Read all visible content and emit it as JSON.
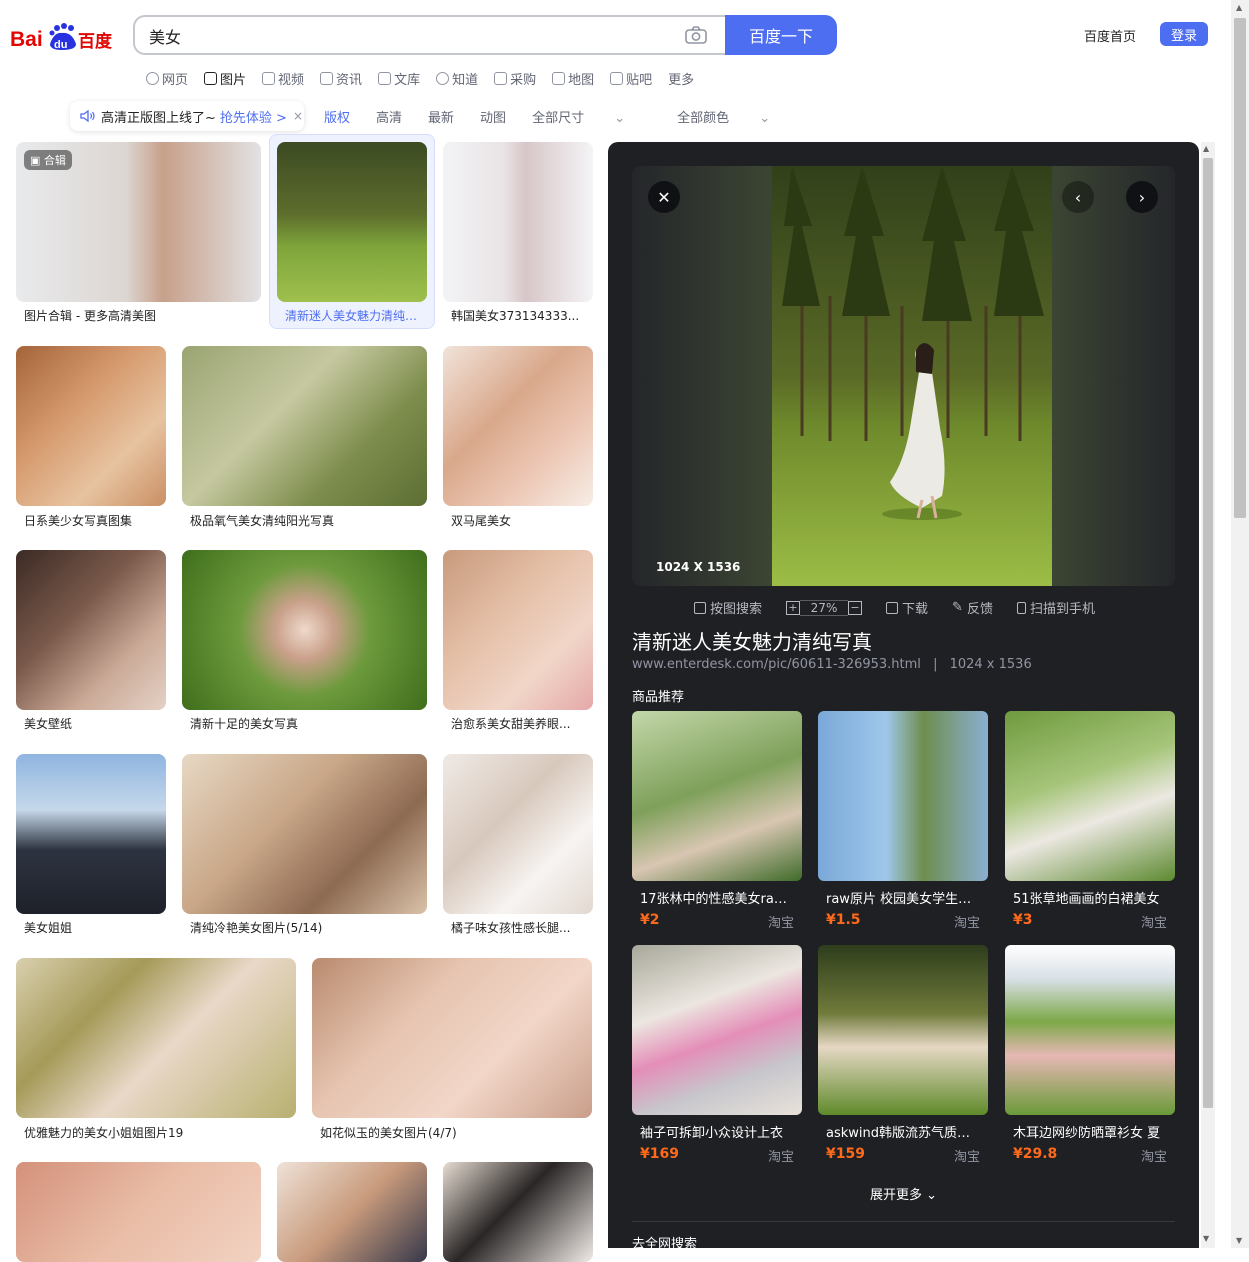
{
  "header": {
    "query": "美女",
    "search_button": "百度一下",
    "home_link": "百度首页",
    "login_button": "登录"
  },
  "nav_tabs": [
    {
      "label": "网页"
    },
    {
      "label": "图片"
    },
    {
      "label": "视频"
    },
    {
      "label": "资讯"
    },
    {
      "label": "文库"
    },
    {
      "label": "知道"
    },
    {
      "label": "采购"
    },
    {
      "label": "地图"
    },
    {
      "label": "贴吧"
    },
    {
      "label": "更多"
    }
  ],
  "banner": {
    "text": "高清正版图上线了~",
    "link": "抢先体验 >",
    "close": "×"
  },
  "filters": [
    "版权",
    "高清",
    "最新",
    "动图",
    "全部尺寸",
    "全部颜色"
  ],
  "album_badge": "合辑",
  "results": [
    "图片合辑 - 更多高清美图",
    "清新迷人美女魅力清纯写真",
    "韩国美女373134333...",
    "日系美少女写真图集",
    "极品氧气美女清纯阳光写真",
    "双马尾美女",
    "美女壁纸",
    "清新十足的美女写真",
    "治愈系美女甜美养眼...",
    "美女姐姐",
    "清纯冷艳美女图片(5/14)",
    "橘子味女孩性感长腿...",
    "优雅魅力的美女小姐姐图片19",
    "如花似玉的美女图片(4/7)"
  ],
  "detail": {
    "dimensions": "1024 X 1536",
    "tool_search": "按图搜索",
    "zoom_value": "27%",
    "zoom_plus": "+",
    "zoom_minus": "−",
    "tool_download": "下载",
    "tool_feedback": "反馈",
    "tool_phone": "扫描到手机",
    "title": "清新迷人美女魅力清纯写真",
    "url": "www.enterdesk.com/pic/60611-326953.html",
    "size_text": "1024 x 1536",
    "section_label": "商品推荐",
    "products": [
      {
        "name": "17张林中的性感美女raw原片",
        "price": "¥2",
        "shop": "淘宝"
      },
      {
        "name": "raw原片 校园美女学生写真",
        "price": "¥1.5",
        "shop": "淘宝"
      },
      {
        "name": "51张草地画画的白裙美女",
        "price": "¥3",
        "shop": "淘宝"
      },
      {
        "name": "袖子可拆卸小众设计上衣",
        "price": "¥169",
        "shop": "淘宝"
      },
      {
        "name": "askwind韩版流苏气质温柔",
        "price": "¥159",
        "shop": "淘宝"
      },
      {
        "name": "木耳边网纱防晒罩衫女 夏",
        "price": "¥29.8",
        "shop": "淘宝"
      }
    ],
    "expand": "展开更多",
    "go_search": "去全网搜索"
  },
  "colors": {
    "brand_blue": "#4e6ef2",
    "panel_bg": "#1f2024",
    "price_orange": "#ff6a1a"
  }
}
